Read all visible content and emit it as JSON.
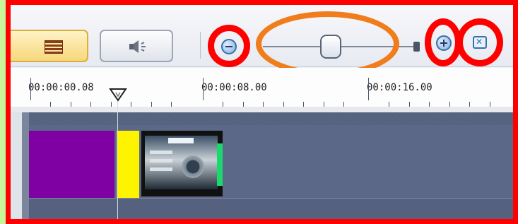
{
  "toolbar": {
    "view_button_icon": "timeline-view-icon",
    "audio_button_icon": "speaker-icon",
    "zoom_out_icon": "zoom-out-icon",
    "zoom_in_icon": "zoom-in-icon",
    "fit_icon": "fit-to-window-icon",
    "zoom_level": 0.45,
    "highlight_color": "#f07c1b",
    "annotation_color": "#ff0000"
  },
  "ruler": {
    "labels": [
      "00:00:00.08",
      "00:00:08.00",
      "00:00:16.00"
    ]
  },
  "timeline": {
    "clips": [
      "purple-color-clip",
      "yellow-color-clip",
      "video-clip"
    ],
    "track_color": "#54617e"
  }
}
